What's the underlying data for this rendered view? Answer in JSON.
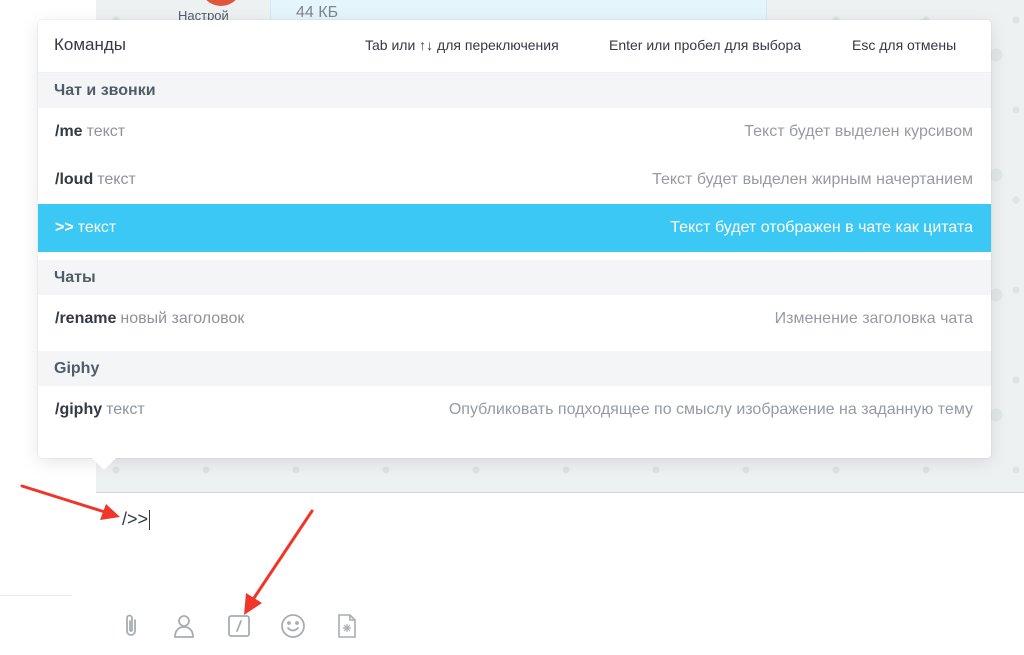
{
  "background": {
    "settings_label": "Настрой",
    "file_size": "44 КБ"
  },
  "popup": {
    "title": "Команды",
    "hints": [
      "Tab или ↑↓ для переключения",
      "Enter или пробел для выбора",
      "Esc для отмены"
    ],
    "sections": [
      {
        "title": "Чат и звонки",
        "commands": [
          {
            "command": "/me",
            "argument": "текст",
            "description": "Текст будет выделен курсивом"
          },
          {
            "command": "/loud",
            "argument": "текст",
            "description": "Текст будет выделен жирным начертанием"
          },
          {
            "command": ">>",
            "argument": "текст",
            "description": "Текст будет отображен в чате как цитата",
            "selected": true
          }
        ]
      },
      {
        "title": "Чаты",
        "commands": [
          {
            "command": "/rename",
            "argument": "новый заголовок",
            "description": "Изменение заголовка чата"
          }
        ]
      },
      {
        "title": "Giphy",
        "commands": [
          {
            "command": "/giphy",
            "argument": "текст",
            "description": "Опубликовать подходящее по смыслу изображение на заданную тему"
          }
        ]
      }
    ]
  },
  "input": {
    "value": "/>>"
  },
  "toolbar": {
    "icons": [
      "paperclip-icon",
      "contact-icon",
      "command-icon",
      "smiley-icon",
      "sticker-file-icon"
    ]
  },
  "colors": {
    "selection": "#3bc8f5",
    "annotation_arrow": "#f0352b",
    "icon": "#a8adb4"
  }
}
